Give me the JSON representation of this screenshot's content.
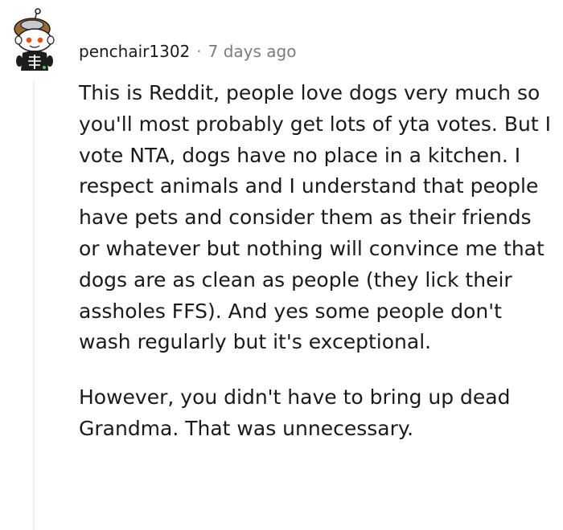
{
  "comment": {
    "author": "penchair1302",
    "separator": "·",
    "timestamp": "7 days ago",
    "paragraphs": [
      "This is Reddit, people love dogs very much so you'll most probably get lots of yta votes. But I vote NTA, dogs have no place in a kitchen. I respect animals and I understand that people have pets and consider them as their friends or whatever but nothing will convince me that dogs are as clean as people (they lick their assholes FFS). And yes some people don't wash regularly but it's exceptional.",
      "However, you didn't have to bring up dead Grandma. That was unnecessary."
    ],
    "avatar": {
      "icon": "snoo-avatar-icon",
      "hair_color": "#9a6a35",
      "hat_color": "#d9d9d9"
    }
  }
}
